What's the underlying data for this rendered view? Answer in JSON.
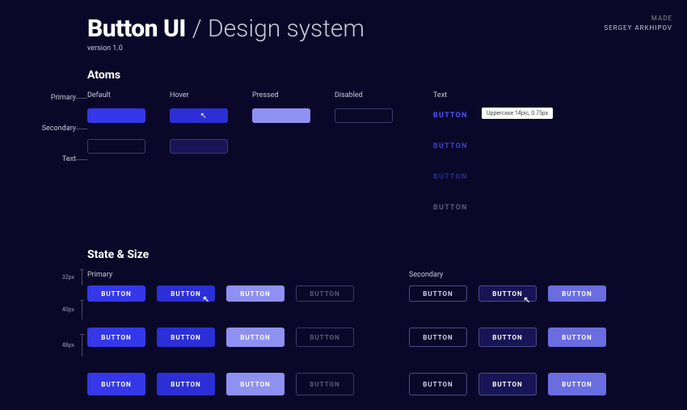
{
  "header": {
    "title_bold": "Button UI",
    "title_light": "/ Design system",
    "version": "version 1.0",
    "credits_made": "MADE",
    "credits_author": "SERGEY ARKHIPOV"
  },
  "atoms": {
    "section_title": "Atoms",
    "col_heads": [
      "Default",
      "Hover",
      "Pressed",
      "Disabled",
      "Text"
    ],
    "row_labels": [
      "Primary",
      "Secondary",
      "Text"
    ],
    "text_samples": [
      "BUTTON",
      "BUTTON",
      "BUTTON",
      "BUTTON"
    ],
    "tooltip": "Uppercase 14pic, 0.75px"
  },
  "state_size": {
    "section_title": "State & Size",
    "group_primary": "Primary",
    "group_secondary": "Secondary",
    "button_label": "BUTTON",
    "sizes": [
      "32px",
      "40px",
      "48px"
    ]
  },
  "colors": {
    "bg": "#0a0828",
    "primary": "#3538e8",
    "primary_hover": "#2c2fd6",
    "primary_pressed": "#8f91f2",
    "outline": "#3a3d6c"
  }
}
